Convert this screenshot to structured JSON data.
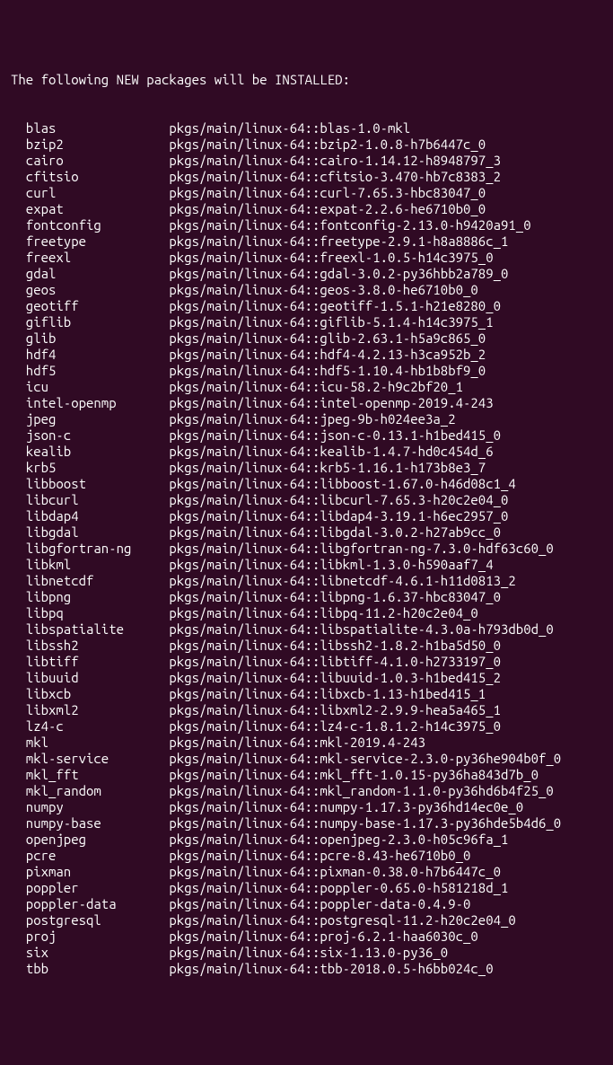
{
  "header": "The following NEW packages will be INSTALLED:",
  "packages": [
    {
      "name": "blas",
      "spec": "pkgs/main/linux-64::blas-1.0-mkl"
    },
    {
      "name": "bzip2",
      "spec": "pkgs/main/linux-64::bzip2-1.0.8-h7b6447c_0"
    },
    {
      "name": "cairo",
      "spec": "pkgs/main/linux-64::cairo-1.14.12-h8948797_3"
    },
    {
      "name": "cfitsio",
      "spec": "pkgs/main/linux-64::cfitsio-3.470-hb7c8383_2"
    },
    {
      "name": "curl",
      "spec": "pkgs/main/linux-64::curl-7.65.3-hbc83047_0"
    },
    {
      "name": "expat",
      "spec": "pkgs/main/linux-64::expat-2.2.6-he6710b0_0"
    },
    {
      "name": "fontconfig",
      "spec": "pkgs/main/linux-64::fontconfig-2.13.0-h9420a91_0"
    },
    {
      "name": "freetype",
      "spec": "pkgs/main/linux-64::freetype-2.9.1-h8a8886c_1"
    },
    {
      "name": "freexl",
      "spec": "pkgs/main/linux-64::freexl-1.0.5-h14c3975_0"
    },
    {
      "name": "gdal",
      "spec": "pkgs/main/linux-64::gdal-3.0.2-py36hbb2a789_0"
    },
    {
      "name": "geos",
      "spec": "pkgs/main/linux-64::geos-3.8.0-he6710b0_0"
    },
    {
      "name": "geotiff",
      "spec": "pkgs/main/linux-64::geotiff-1.5.1-h21e8280_0"
    },
    {
      "name": "giflib",
      "spec": "pkgs/main/linux-64::giflib-5.1.4-h14c3975_1"
    },
    {
      "name": "glib",
      "spec": "pkgs/main/linux-64::glib-2.63.1-h5a9c865_0"
    },
    {
      "name": "hdf4",
      "spec": "pkgs/main/linux-64::hdf4-4.2.13-h3ca952b_2"
    },
    {
      "name": "hdf5",
      "spec": "pkgs/main/linux-64::hdf5-1.10.4-hb1b8bf9_0"
    },
    {
      "name": "icu",
      "spec": "pkgs/main/linux-64::icu-58.2-h9c2bf20_1"
    },
    {
      "name": "intel-openmp",
      "spec": "pkgs/main/linux-64::intel-openmp-2019.4-243"
    },
    {
      "name": "jpeg",
      "spec": "pkgs/main/linux-64::jpeg-9b-h024ee3a_2"
    },
    {
      "name": "json-c",
      "spec": "pkgs/main/linux-64::json-c-0.13.1-h1bed415_0"
    },
    {
      "name": "kealib",
      "spec": "pkgs/main/linux-64::kealib-1.4.7-hd0c454d_6"
    },
    {
      "name": "krb5",
      "spec": "pkgs/main/linux-64::krb5-1.16.1-h173b8e3_7"
    },
    {
      "name": "libboost",
      "spec": "pkgs/main/linux-64::libboost-1.67.0-h46d08c1_4"
    },
    {
      "name": "libcurl",
      "spec": "pkgs/main/linux-64::libcurl-7.65.3-h20c2e04_0"
    },
    {
      "name": "libdap4",
      "spec": "pkgs/main/linux-64::libdap4-3.19.1-h6ec2957_0"
    },
    {
      "name": "libgdal",
      "spec": "pkgs/main/linux-64::libgdal-3.0.2-h27ab9cc_0"
    },
    {
      "name": "libgfortran-ng",
      "spec": "pkgs/main/linux-64::libgfortran-ng-7.3.0-hdf63c60_0"
    },
    {
      "name": "libkml",
      "spec": "pkgs/main/linux-64::libkml-1.3.0-h590aaf7_4"
    },
    {
      "name": "libnetcdf",
      "spec": "pkgs/main/linux-64::libnetcdf-4.6.1-h11d0813_2"
    },
    {
      "name": "libpng",
      "spec": "pkgs/main/linux-64::libpng-1.6.37-hbc83047_0"
    },
    {
      "name": "libpq",
      "spec": "pkgs/main/linux-64::libpq-11.2-h20c2e04_0"
    },
    {
      "name": "libspatialite",
      "spec": "pkgs/main/linux-64::libspatialite-4.3.0a-h793db0d_0"
    },
    {
      "name": "libssh2",
      "spec": "pkgs/main/linux-64::libssh2-1.8.2-h1ba5d50_0"
    },
    {
      "name": "libtiff",
      "spec": "pkgs/main/linux-64::libtiff-4.1.0-h2733197_0"
    },
    {
      "name": "libuuid",
      "spec": "pkgs/main/linux-64::libuuid-1.0.3-h1bed415_2"
    },
    {
      "name": "libxcb",
      "spec": "pkgs/main/linux-64::libxcb-1.13-h1bed415_1"
    },
    {
      "name": "libxml2",
      "spec": "pkgs/main/linux-64::libxml2-2.9.9-hea5a465_1"
    },
    {
      "name": "lz4-c",
      "spec": "pkgs/main/linux-64::lz4-c-1.8.1.2-h14c3975_0"
    },
    {
      "name": "mkl",
      "spec": "pkgs/main/linux-64::mkl-2019.4-243"
    },
    {
      "name": "mkl-service",
      "spec": "pkgs/main/linux-64::mkl-service-2.3.0-py36he904b0f_0"
    },
    {
      "name": "mkl_fft",
      "spec": "pkgs/main/linux-64::mkl_fft-1.0.15-py36ha843d7b_0"
    },
    {
      "name": "mkl_random",
      "spec": "pkgs/main/linux-64::mkl_random-1.1.0-py36hd6b4f25_0"
    },
    {
      "name": "numpy",
      "spec": "pkgs/main/linux-64::numpy-1.17.3-py36hd14ec0e_0"
    },
    {
      "name": "numpy-base",
      "spec": "pkgs/main/linux-64::numpy-base-1.17.3-py36hde5b4d6_0"
    },
    {
      "name": "openjpeg",
      "spec": "pkgs/main/linux-64::openjpeg-2.3.0-h05c96fa_1"
    },
    {
      "name": "pcre",
      "spec": "pkgs/main/linux-64::pcre-8.43-he6710b0_0"
    },
    {
      "name": "pixman",
      "spec": "pkgs/main/linux-64::pixman-0.38.0-h7b6447c_0"
    },
    {
      "name": "poppler",
      "spec": "pkgs/main/linux-64::poppler-0.65.0-h581218d_1"
    },
    {
      "name": "poppler-data",
      "spec": "pkgs/main/linux-64::poppler-data-0.4.9-0"
    },
    {
      "name": "postgresql",
      "spec": "pkgs/main/linux-64::postgresql-11.2-h20c2e04_0"
    },
    {
      "name": "proj",
      "spec": "pkgs/main/linux-64::proj-6.2.1-haa6030c_0"
    },
    {
      "name": "six",
      "spec": "pkgs/main/linux-64::six-1.13.0-py36_0"
    },
    {
      "name": "tbb",
      "spec": "pkgs/main/linux-64::tbb-2018.0.5-h6bb024c_0"
    }
  ]
}
